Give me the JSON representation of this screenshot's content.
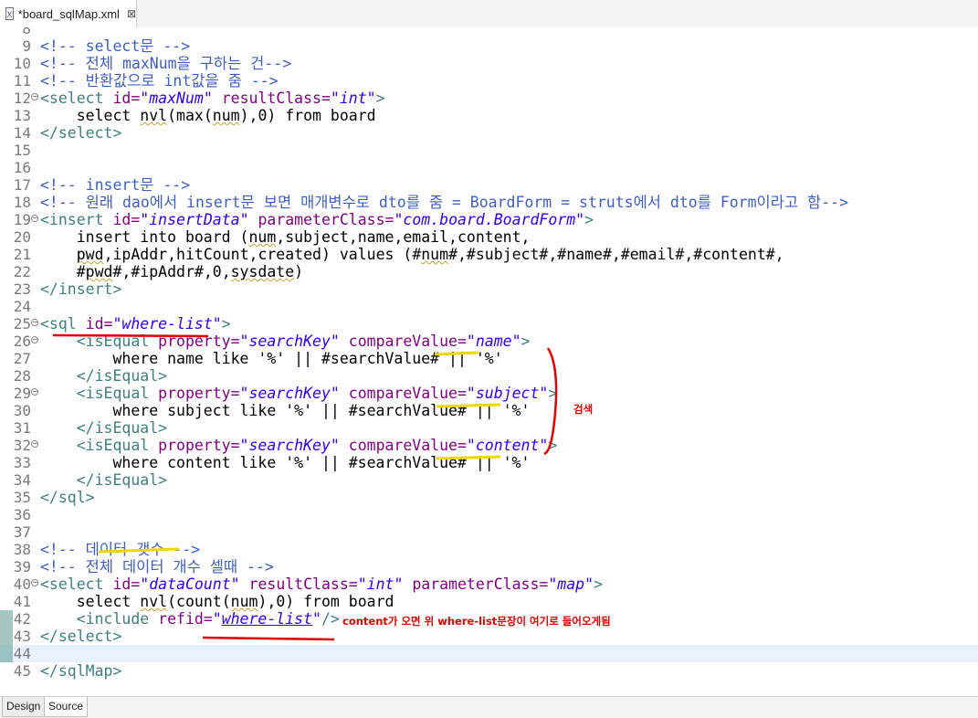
{
  "tab": {
    "title": "*board_sqlMap.xml",
    "close": "⊠"
  },
  "bottom_tabs": [
    {
      "label": "Design"
    },
    {
      "label": "Source"
    }
  ],
  "annotations": {
    "search_label": "검색",
    "include_note": "content가 오면 위 where-list문장이 여기로 들어오게됨"
  },
  "editor": {
    "current_line": "44",
    "lines": [
      {
        "n": "8",
        "fold": false,
        "segs": []
      },
      {
        "n": "9",
        "fold": false,
        "segs": [
          {
            "t": "<!-- select문 -->",
            "c": "c-com"
          }
        ]
      },
      {
        "n": "10",
        "fold": false,
        "segs": [
          {
            "t": "<!-- 전체 maxNum을 구하는 건-->",
            "c": "c-com"
          }
        ]
      },
      {
        "n": "11",
        "fold": false,
        "segs": [
          {
            "t": "<!-- 반환값으로 int값을 줌 -->",
            "c": "c-com"
          }
        ]
      },
      {
        "n": "12",
        "fold": true,
        "segs": [
          {
            "t": "<select ",
            "c": "c-tag"
          },
          {
            "t": "id=",
            "c": "c-attr"
          },
          {
            "t": "\"maxNum\"",
            "c": "c-val"
          },
          {
            "t": " resultClass=",
            "c": "c-attr"
          },
          {
            "t": "\"int\"",
            "c": "c-val"
          },
          {
            "t": ">",
            "c": "c-tag"
          }
        ]
      },
      {
        "n": "13",
        "fold": false,
        "segs": [
          {
            "t": "    select ",
            "c": "c-txt"
          },
          {
            "t": "nvl",
            "c": "c-txt squig"
          },
          {
            "t": "(max(",
            "c": "c-txt"
          },
          {
            "t": "num",
            "c": "c-txt squig"
          },
          {
            "t": "),0) from board",
            "c": "c-txt"
          }
        ]
      },
      {
        "n": "14",
        "fold": false,
        "segs": [
          {
            "t": "</select>",
            "c": "c-tag"
          }
        ]
      },
      {
        "n": "15",
        "fold": false,
        "segs": []
      },
      {
        "n": "16",
        "fold": false,
        "segs": []
      },
      {
        "n": "17",
        "fold": false,
        "segs": [
          {
            "t": "<!-- insert문 -->",
            "c": "c-com"
          }
        ]
      },
      {
        "n": "18",
        "fold": false,
        "segs": [
          {
            "t": "<!-- 원래 dao에서 insert문 보면 매개변수로 dto를 줌 = BoardForm = struts에서 dto를 Form이라고 함-->",
            "c": "c-com"
          }
        ]
      },
      {
        "n": "19",
        "fold": true,
        "segs": [
          {
            "t": "<insert ",
            "c": "c-tag"
          },
          {
            "t": "id=",
            "c": "c-attr"
          },
          {
            "t": "\"insertData\"",
            "c": "c-val"
          },
          {
            "t": " parameterClass=",
            "c": "c-attr"
          },
          {
            "t": "\"com.board.BoardForm\"",
            "c": "c-val"
          },
          {
            "t": ">",
            "c": "c-tag"
          }
        ]
      },
      {
        "n": "20",
        "fold": false,
        "segs": [
          {
            "t": "    insert into board (",
            "c": "c-txt"
          },
          {
            "t": "num",
            "c": "c-txt squig"
          },
          {
            "t": ",subject,name,email,content,",
            "c": "c-txt"
          }
        ]
      },
      {
        "n": "21",
        "fold": false,
        "segs": [
          {
            "t": "    ",
            "c": "c-txt"
          },
          {
            "t": "pwd",
            "c": "c-txt squig"
          },
          {
            "t": ",ipAddr,hitCount,created) values (#",
            "c": "c-txt"
          },
          {
            "t": "num",
            "c": "c-txt squig"
          },
          {
            "t": "#,#subject#,#name#,#email#,#content#,",
            "c": "c-txt"
          }
        ]
      },
      {
        "n": "22",
        "fold": false,
        "segs": [
          {
            "t": "    #",
            "c": "c-txt"
          },
          {
            "t": "pwd",
            "c": "c-txt squig"
          },
          {
            "t": "#,#ipAddr#,0,",
            "c": "c-txt"
          },
          {
            "t": "sysdate",
            "c": "c-txt squig"
          },
          {
            "t": ")",
            "c": "c-txt"
          }
        ]
      },
      {
        "n": "23",
        "fold": false,
        "segs": [
          {
            "t": "</insert>",
            "c": "c-tag"
          }
        ]
      },
      {
        "n": "24",
        "fold": false,
        "segs": []
      },
      {
        "n": "25",
        "fold": true,
        "segs": [
          {
            "t": "<sql ",
            "c": "c-tag"
          },
          {
            "t": "id=",
            "c": "c-attr"
          },
          {
            "t": "\"where-list\"",
            "c": "c-val"
          },
          {
            "t": ">",
            "c": "c-tag"
          }
        ]
      },
      {
        "n": "26",
        "fold": true,
        "segs": [
          {
            "t": "    <isEqual ",
            "c": "c-tag"
          },
          {
            "t": "property=",
            "c": "c-attr"
          },
          {
            "t": "\"searchKey\"",
            "c": "c-val"
          },
          {
            "t": " compareValue=",
            "c": "c-attr"
          },
          {
            "t": "\"name\"",
            "c": "c-val"
          },
          {
            "t": ">",
            "c": "c-tag"
          }
        ]
      },
      {
        "n": "27",
        "fold": false,
        "segs": [
          {
            "t": "        where name like '%' || #searchValue# || '%'",
            "c": "c-txt"
          }
        ]
      },
      {
        "n": "28",
        "fold": false,
        "segs": [
          {
            "t": "    </isEqual>",
            "c": "c-tag"
          }
        ]
      },
      {
        "n": "29",
        "fold": true,
        "segs": [
          {
            "t": "    <isEqual ",
            "c": "c-tag"
          },
          {
            "t": "property=",
            "c": "c-attr"
          },
          {
            "t": "\"searchKey\"",
            "c": "c-val"
          },
          {
            "t": " compareValue=",
            "c": "c-attr"
          },
          {
            "t": "\"subject\"",
            "c": "c-val"
          },
          {
            "t": ">",
            "c": "c-tag"
          }
        ]
      },
      {
        "n": "30",
        "fold": false,
        "segs": [
          {
            "t": "        where subject like '%' || #searchValue# || '%'",
            "c": "c-txt"
          }
        ]
      },
      {
        "n": "31",
        "fold": false,
        "segs": [
          {
            "t": "    </isEqual>",
            "c": "c-tag"
          }
        ]
      },
      {
        "n": "32",
        "fold": true,
        "segs": [
          {
            "t": "    <isEqual ",
            "c": "c-tag"
          },
          {
            "t": "property=",
            "c": "c-attr"
          },
          {
            "t": "\"searchKey\"",
            "c": "c-val"
          },
          {
            "t": " compareValue=",
            "c": "c-attr"
          },
          {
            "t": "\"content\"",
            "c": "c-val"
          },
          {
            "t": ">",
            "c": "c-tag"
          }
        ]
      },
      {
        "n": "33",
        "fold": false,
        "segs": [
          {
            "t": "        where content like '%' || #searchValue# || '%'",
            "c": "c-txt"
          }
        ]
      },
      {
        "n": "34",
        "fold": false,
        "segs": [
          {
            "t": "    </isEqual>",
            "c": "c-tag"
          }
        ]
      },
      {
        "n": "35",
        "fold": false,
        "segs": [
          {
            "t": "</sql>",
            "c": "c-tag"
          }
        ]
      },
      {
        "n": "36",
        "fold": false,
        "segs": []
      },
      {
        "n": "37",
        "fold": false,
        "segs": []
      },
      {
        "n": "38",
        "fold": false,
        "segs": [
          {
            "t": "<!-- 데이터 갯수 -->",
            "c": "c-com"
          }
        ]
      },
      {
        "n": "39",
        "fold": false,
        "segs": [
          {
            "t": "<!-- 전체 데이터 개수 셀때 -->",
            "c": "c-com"
          }
        ]
      },
      {
        "n": "40",
        "fold": true,
        "segs": [
          {
            "t": "<select ",
            "c": "c-tag"
          },
          {
            "t": "id=",
            "c": "c-attr"
          },
          {
            "t": "\"dataCount\"",
            "c": "c-val"
          },
          {
            "t": " resultClass=",
            "c": "c-attr"
          },
          {
            "t": "\"int\"",
            "c": "c-val"
          },
          {
            "t": " parameterClass=",
            "c": "c-attr"
          },
          {
            "t": "\"map\"",
            "c": "c-val"
          },
          {
            "t": ">",
            "c": "c-tag"
          }
        ]
      },
      {
        "n": "41",
        "fold": false,
        "segs": [
          {
            "t": "    select ",
            "c": "c-txt"
          },
          {
            "t": "nvl",
            "c": "c-txt squig"
          },
          {
            "t": "(count(",
            "c": "c-txt"
          },
          {
            "t": "num",
            "c": "c-txt squig"
          },
          {
            "t": "),0) from board",
            "c": "c-txt"
          }
        ]
      },
      {
        "n": "42",
        "fold": false,
        "segs": [
          {
            "t": "    <include ",
            "c": "c-tag"
          },
          {
            "t": "refid=",
            "c": "c-attr"
          },
          {
            "t": "\"",
            "c": "c-val"
          },
          {
            "t": "where-list",
            "c": "c-val hl-link"
          },
          {
            "t": "\"",
            "c": "c-val"
          },
          {
            "t": "/>",
            "c": "c-tag"
          }
        ]
      },
      {
        "n": "43",
        "fold": false,
        "segs": [
          {
            "t": "</select>",
            "c": "c-tag"
          }
        ]
      },
      {
        "n": "44",
        "fold": false,
        "segs": []
      },
      {
        "n": "45",
        "fold": false,
        "segs": [
          {
            "t": "</sqlMap>",
            "c": "c-tag"
          }
        ]
      }
    ]
  }
}
